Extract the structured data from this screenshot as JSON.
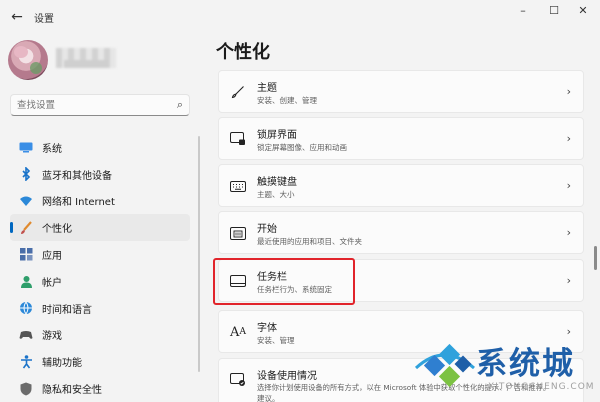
{
  "window": {
    "back_glyph": "←",
    "title": "设置",
    "minimize_glyph": "–",
    "maximize_glyph": "☐",
    "close_glyph": "✕"
  },
  "search": {
    "placeholder": "查找设置",
    "icon": "search-icon"
  },
  "sidebar": {
    "items": [
      {
        "label": "系统",
        "icon": "system-icon"
      },
      {
        "label": "蓝牙和其他设备",
        "icon": "bluetooth-icon"
      },
      {
        "label": "网络和 Internet",
        "icon": "network-icon"
      },
      {
        "label": "个性化",
        "icon": "personalization-icon",
        "selected": true
      },
      {
        "label": "应用",
        "icon": "apps-icon"
      },
      {
        "label": "帐户",
        "icon": "account-icon"
      },
      {
        "label": "时间和语言",
        "icon": "time-language-icon"
      },
      {
        "label": "游戏",
        "icon": "gaming-icon"
      },
      {
        "label": "辅助功能",
        "icon": "accessibility-icon"
      },
      {
        "label": "隐私和安全性",
        "icon": "privacy-icon"
      }
    ]
  },
  "main": {
    "title": "个性化",
    "cards": [
      {
        "title": "主题",
        "subtitle": "安装、创建、管理",
        "icon": "brush-icon"
      },
      {
        "title": "锁屏界面",
        "subtitle": "锁定屏幕图像、应用和动画",
        "icon": "lock-screen-icon"
      },
      {
        "title": "触摸键盘",
        "subtitle": "主题、大小",
        "icon": "keyboard-icon"
      },
      {
        "title": "开始",
        "subtitle": "最近使用的应用和项目、文件夹",
        "icon": "start-icon"
      },
      {
        "title": "任务栏",
        "subtitle": "任务栏行为、系统固定",
        "icon": "taskbar-icon"
      },
      {
        "title": "字体",
        "subtitle": "安装、管理",
        "icon": "font-icon"
      },
      {
        "title": "设备使用情况",
        "subtitle": "选择你计划使用设备的所有方式，以在 Microsoft 体验中获取个性化的提示、广告和推荐。",
        "subtitle_line2": "建议。",
        "icon": "device-usage-icon"
      }
    ],
    "chevron_glyph": "›"
  },
  "watermark": {
    "text": "系统城",
    "url": "XITONGCHENG.COM",
    "colors": [
      "#1f5fa8",
      "#2fa2dc",
      "#7cc242"
    ]
  },
  "colors": {
    "accent": "#0067c0",
    "highlight": "#e1242b",
    "background": "#f3f3f3"
  }
}
